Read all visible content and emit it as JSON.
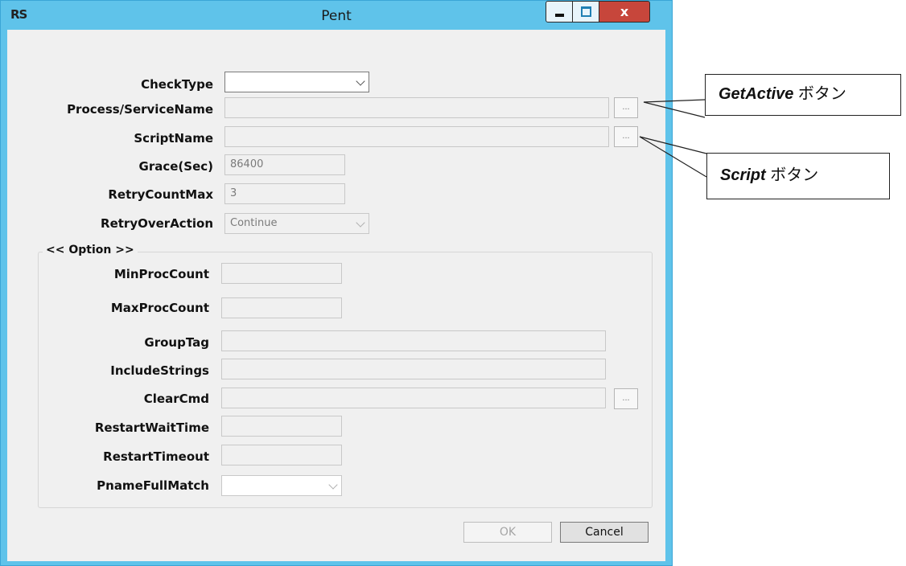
{
  "window": {
    "title": "Pent",
    "app_icon": "RS",
    "close_label": "x"
  },
  "form": {
    "check_type_label": "CheckType",
    "check_type_value": "",
    "process_service_name_label": "Process/ServiceName",
    "script_name_label": "ScriptName",
    "grace_label": "Grace(Sec)",
    "grace_value": "86400",
    "retry_count_max_label": "RetryCountMax",
    "retry_count_max_value": "3",
    "retry_over_action_label": "RetryOverAction",
    "retry_over_action_value": "Continue",
    "browse_label": "..."
  },
  "option": {
    "group_title": "<< Option >>",
    "min_proc_count_label": "MinProcCount",
    "max_proc_count_label": "MaxProcCount",
    "group_tag_label": "GroupTag",
    "include_strings_label": "IncludeStrings",
    "clear_cmd_label": "ClearCmd",
    "restart_wait_time_label": "RestartWaitTime",
    "restart_timeout_label": "RestartTimeout",
    "pname_full_match_label": "PnameFullMatch"
  },
  "buttons": {
    "ok": "OK",
    "cancel": "Cancel"
  },
  "callouts": {
    "get_active_em": "GetActive",
    "get_active_rest": " ボタン",
    "script_em": "Script",
    "script_rest": " ボタン"
  },
  "icons": [
    "rs-app-icon",
    "minimize-icon",
    "maximize-icon",
    "close-icon",
    "chevron-down-icon"
  ],
  "colors": {
    "titlebar": "#5fc3ea",
    "close_button": "#c7463b",
    "client_bg": "#f0f0f0"
  }
}
